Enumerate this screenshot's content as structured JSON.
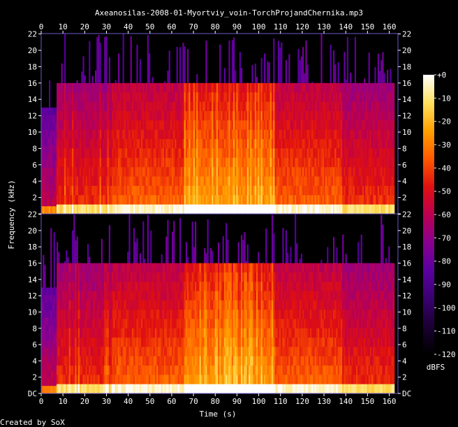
{
  "chart_data": {
    "type": "heatmap",
    "title": "Axeanosilas-2008-01-Myortviy_voin-TorchProjandChernika.mp3",
    "xlabel": "Time (s)",
    "ylabel": "Frequency (kHz)",
    "credit": "Created by SoX",
    "xlim": [
      0,
      164
    ],
    "ylim": [
      0,
      22.05
    ],
    "x_ticks": [
      0,
      10,
      20,
      30,
      40,
      50,
      60,
      70,
      80,
      90,
      100,
      110,
      120,
      130,
      140,
      150,
      160
    ],
    "x_tick_labels": [
      "0",
      "10",
      "20",
      "30",
      "40",
      "50",
      "60",
      "70",
      "80",
      "90",
      "100",
      "110",
      "120",
      "130",
      "140",
      "150",
      "160"
    ],
    "y_ticks": [
      0,
      2,
      4,
      6,
      8,
      10,
      12,
      14,
      16,
      18,
      20,
      22
    ],
    "y_tick_labels_top_channel": [
      "",
      "2",
      "4",
      "6",
      "8",
      "10",
      "12",
      "14",
      "16",
      "18",
      "20",
      "22"
    ],
    "y_tick_labels_bottom_channel": [
      "DC",
      "2",
      "4",
      "6",
      "8",
      "10",
      "12",
      "14",
      "16",
      "18",
      "20",
      "22"
    ],
    "channels": 2,
    "colorbar": {
      "label": "dBFS",
      "range": [
        -120,
        0
      ],
      "ticks": [
        0,
        -10,
        -20,
        -30,
        -40,
        -50,
        -60,
        -70,
        -80,
        -90,
        -100,
        -110,
        -120
      ],
      "tick_labels": [
        "+0",
        "-10",
        "-20",
        "-30",
        "-40",
        "-50",
        "-60",
        "-70",
        "-80",
        "-90",
        "-100",
        "-110",
        "-120"
      ],
      "colors": [
        "#000000",
        "#1a0033",
        "#3a0070",
        "#5a00a0",
        "#8a0090",
        "#bb0050",
        "#e01010",
        "#ff5a00",
        "#ffa000",
        "#ffe060",
        "#ffffff"
      ]
    },
    "segments": [
      {
        "t": [
          0,
          7
        ],
        "cutoff_khz": 13,
        "level": "low"
      },
      {
        "t": [
          7,
          32
        ],
        "cutoff_khz": 16,
        "level": "medium",
        "transients": "sparse"
      },
      {
        "t": [
          32,
          65
        ],
        "cutoff_khz": 16,
        "level": "high"
      },
      {
        "t": [
          65,
          107
        ],
        "cutoff_khz": 16,
        "level": "very high",
        "transients": "dense"
      },
      {
        "t": [
          107,
          138
        ],
        "cutoff_khz": 16,
        "level": "high"
      },
      {
        "t": [
          138,
          162
        ],
        "cutoff_khz": 16,
        "level": "medium"
      }
    ]
  }
}
